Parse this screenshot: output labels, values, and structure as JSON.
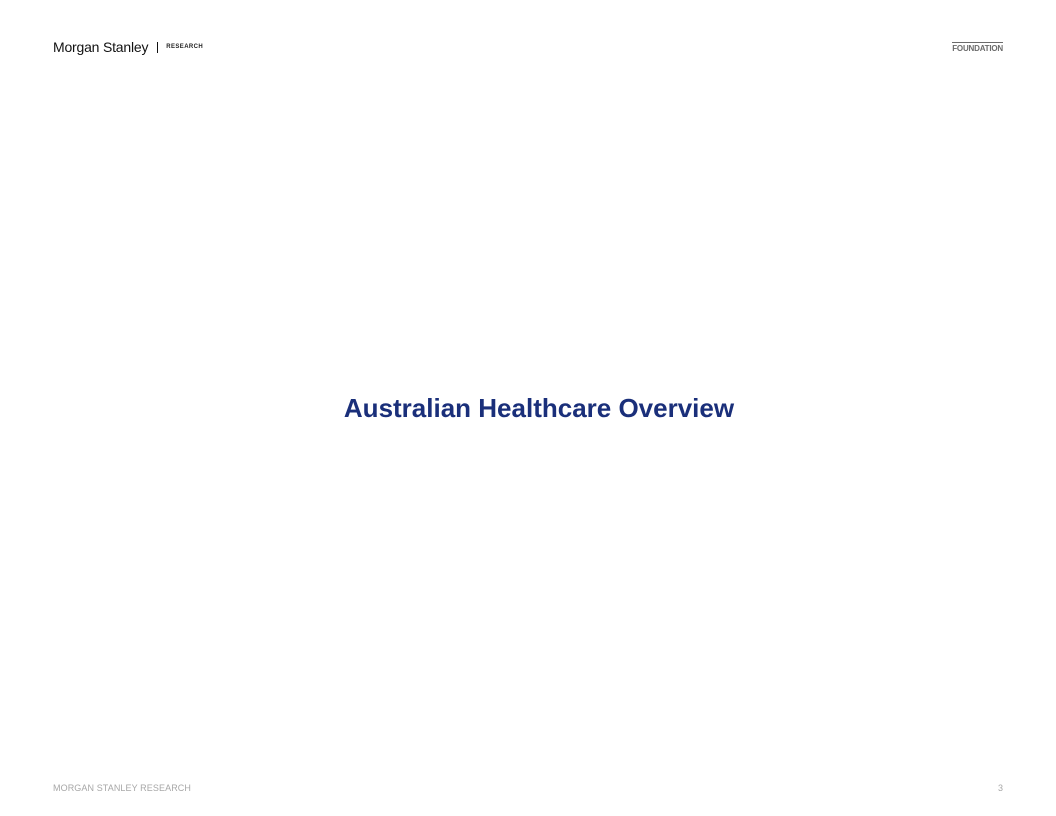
{
  "header": {
    "brand": "Morgan Stanley",
    "brand_sub": "RESEARCH",
    "badge": "FOUNDATION"
  },
  "slide": {
    "title": "Australian Healthcare Overview"
  },
  "footer": {
    "left": "MORGAN STANLEY RESEARCH",
    "page_number": "3"
  },
  "colors": {
    "title": "#1a2f7a",
    "footer_text": "#a7a7a7",
    "badge": "#6b6b6b"
  }
}
